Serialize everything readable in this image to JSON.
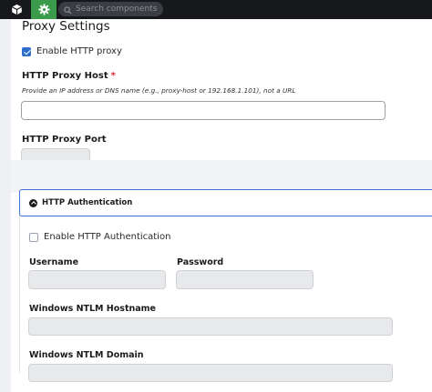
{
  "topbar": {
    "search_placeholder": "Search components"
  },
  "page": {
    "title": "Proxy Settings"
  },
  "proxy": {
    "enable_label": "Enable HTTP proxy",
    "enable_checked": true,
    "host_label": "HTTP Proxy Host",
    "host_required": "*",
    "host_hint": "Provide an IP address or DNS name (e.g., proxy-host or 192.168.1.101), not a URL",
    "host_value": "",
    "port_label": "HTTP Proxy Port",
    "port_value": ""
  },
  "auth": {
    "section_title": "HTTP Authentication",
    "enable_label": "Enable HTTP Authentication",
    "enable_checked": false,
    "username_label": "Username",
    "password_label": "Password",
    "ntlm_host_label": "Windows NTLM Hostname",
    "ntlm_domain_label": "Windows NTLM Domain"
  },
  "colors": {
    "accent": "#3f73d6",
    "active_tab": "#3a9b4a",
    "required": "#d12b2b"
  }
}
